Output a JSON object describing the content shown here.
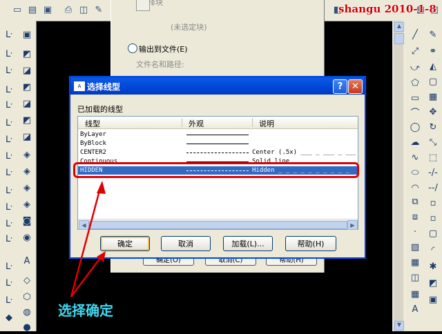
{
  "watermark": "shangu 2010-1-8",
  "background_dialog": {
    "top_text": "选择块",
    "unselected_block": "(未选定块)",
    "output_to_file": "输出到文件(E)",
    "file_path_label": "文件名和路径:",
    "buttons": [
      "确定(O)",
      "取消(C)",
      "帮助(H)"
    ]
  },
  "dialog": {
    "title": "选择线型",
    "loaded_linetypes_label": "已加载的线型",
    "columns": [
      "线型",
      "外观",
      "说明"
    ],
    "rows": [
      {
        "name": "ByLayer",
        "appearance": "solid",
        "description": ""
      },
      {
        "name": "ByBlock",
        "appearance": "solid",
        "description": ""
      },
      {
        "name": "CENTER2",
        "appearance": "center",
        "description": "Center (.5x) ___ _ ___ _ ___"
      },
      {
        "name": "Continuous",
        "appearance": "solid",
        "description": "Solid line"
      },
      {
        "name": "HIDDEN",
        "appearance": "hidden",
        "description": "Hidden _ _ _ _ _ _ _ _ _ _"
      }
    ],
    "selected_row": "HIDDEN",
    "buttons": {
      "ok": "确定",
      "cancel": "取消",
      "load": "加载(L)...",
      "help": "帮助(H)"
    },
    "caption_buttons": {
      "help": "?",
      "close": "✕"
    }
  },
  "annotation": "选择确定",
  "colors": {
    "highlight_red": "#e00000",
    "annotation_cyan": "#40d8f0",
    "selection_blue": "#316ac5"
  }
}
